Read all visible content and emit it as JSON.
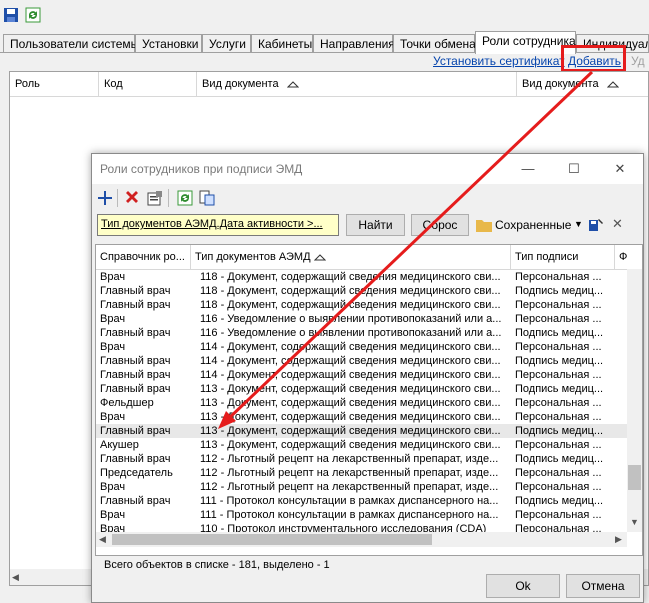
{
  "main_tabs": [
    {
      "label": "Пользователи системы"
    },
    {
      "label": "Установки"
    },
    {
      "label": "Услуги"
    },
    {
      "label": "Кабинеты"
    },
    {
      "label": "Направления"
    },
    {
      "label": "Точки обмена"
    },
    {
      "label": "Роли сотрудника"
    },
    {
      "label": "Индивидуал"
    }
  ],
  "links": {
    "set_certificate": "Установить сертификат",
    "add": "Добавить",
    "remove_partial": "Уд"
  },
  "bg_grid": {
    "columns": [
      "Роль",
      "Код",
      "Вид документа",
      "Вид документа"
    ]
  },
  "dialog": {
    "title": "Роли сотрудников при подписи ЭМД",
    "filter_text": "Тип документов АЭМД.Дата активности >...",
    "find_label": "Найти",
    "reset_label": "Сброс",
    "saved_label": "Сохраненные",
    "columns": [
      "Справочник ро...",
      "Тип документов АЭМД",
      "Тип подписи",
      "Ф"
    ],
    "rows": [
      {
        "role": "Врач",
        "doc": "118 - Документ, содержащий сведения медицинского сви...",
        "sign": "Персональная ..."
      },
      {
        "role": "Главный врач",
        "doc": "118 - Документ, содержащий сведения медицинского сви...",
        "sign": "Подпись медиц..."
      },
      {
        "role": "Главный врач",
        "doc": "118 - Документ, содержащий сведения медицинского сви...",
        "sign": "Персональная ..."
      },
      {
        "role": "Врач",
        "doc": "116 - Уведомление о выявлении противопоказаний или а...",
        "sign": "Персональная ..."
      },
      {
        "role": "Главный врач",
        "doc": "116 - Уведомление о выявлении противопоказаний или а...",
        "sign": "Подпись медиц..."
      },
      {
        "role": "Врач",
        "doc": "114 - Документ, содержащий сведения медицинского сви...",
        "sign": "Персональная ..."
      },
      {
        "role": "Главный врач",
        "doc": "114 - Документ, содержащий сведения медицинского сви...",
        "sign": "Подпись медиц..."
      },
      {
        "role": "Главный врач",
        "doc": "114 - Документ, содержащий сведения медицинского сви...",
        "sign": "Персональная ..."
      },
      {
        "role": "Главный врач",
        "doc": "113 - Документ, содержащий сведения медицинского сви...",
        "sign": "Подпись медиц..."
      },
      {
        "role": "Фельдшер",
        "doc": "113 - Документ, содержащий сведения медицинского сви...",
        "sign": "Персональная ..."
      },
      {
        "role": "Врач",
        "doc": "113 - Документ, содержащий сведения медицинского сви...",
        "sign": "Персональная ..."
      },
      {
        "role": "Главный врач",
        "doc": "113 - Документ, содержащий сведения медицинского сви...",
        "sign": "Подпись медиц..."
      },
      {
        "role": "Акушер",
        "doc": "113 - Документ, содержащий сведения медицинского сви...",
        "sign": "Персональная ..."
      },
      {
        "role": "Главный врач",
        "doc": "112 - Льготный рецепт на лекарственный препарат, изде...",
        "sign": "Подпись медиц..."
      },
      {
        "role": "Председатель",
        "doc": "112 - Льготный рецепт на лекарственный препарат, изде...",
        "sign": "Персональная ..."
      },
      {
        "role": "Врач",
        "doc": "112 - Льготный рецепт на лекарственный препарат, изде...",
        "sign": "Персональная ..."
      },
      {
        "role": "Главный врач",
        "doc": "111 - Протокол консультации в рамках диспансерного на...",
        "sign": "Подпись медиц..."
      },
      {
        "role": "Врач",
        "doc": "111 - Протокол консультации в рамках диспансерного на...",
        "sign": "Персональная ..."
      },
      {
        "role": "Врач",
        "doc": "110 - Протокол инструментального исследования (CDA)",
        "sign": "Персональная ..."
      }
    ],
    "selected_row": 11,
    "status": "Всего объектов в списке - 181, выделено - 1",
    "ok_label": "Ok",
    "cancel_label": "Отмена"
  },
  "colors": {
    "highlight": "#e51c1c",
    "link": "#0645ad",
    "filter_bg": "#ffffc8"
  }
}
